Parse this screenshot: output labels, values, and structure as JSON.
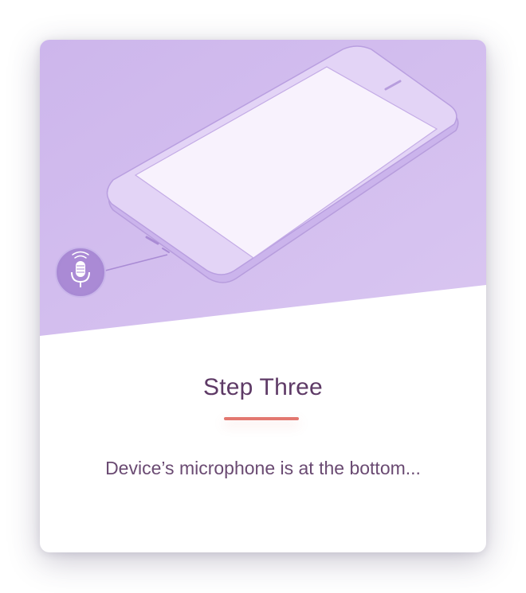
{
  "card": {
    "title": "Step Three",
    "description": "Device’s microphone is at the bottom..."
  },
  "illustration": {
    "subject": "smartphone",
    "icon": "microphone-icon"
  },
  "colors": {
    "hero_background": "#d6c3ef",
    "phone_body": "#e2d3f5",
    "phone_screen": "#f7f1fd",
    "mic_badge": "#ab8ad6",
    "title": "#5e3a66",
    "accent": "#e2776f",
    "description": "#6a4a72"
  }
}
